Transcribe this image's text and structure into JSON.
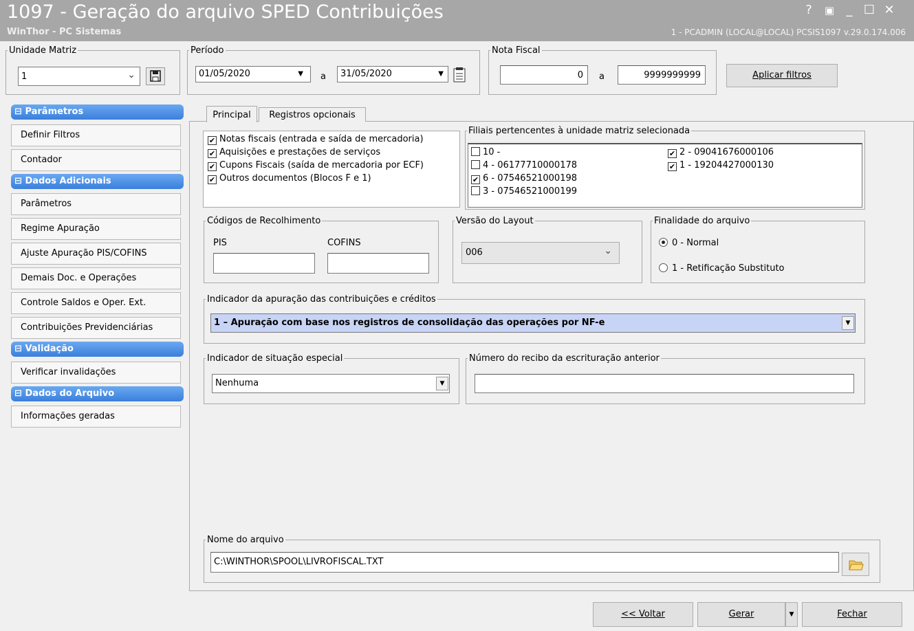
{
  "window": {
    "title": "1097 - Geração do arquivo SPED Contribuições",
    "subtitle": "WinThor - PC Sistemas",
    "user_info": "1 - PCADMIN (LOCAL@LOCAL)  PCSIS1097  v.29.0.174.006",
    "controls": [
      "?",
      "▣",
      "_",
      "☐",
      "✕"
    ]
  },
  "unidade_matriz": {
    "legend": "Unidade Matriz",
    "value": "1"
  },
  "periodo": {
    "legend": "Período",
    "from": "01/05/2020",
    "sep": "a",
    "to": "31/05/2020"
  },
  "nota_fiscal": {
    "legend": "Nota Fiscal",
    "from": "0",
    "sep": "a",
    "to": "9999999999"
  },
  "apply_button": "Aplicar filtros",
  "sidebar": {
    "sections": [
      {
        "header": "Parâmetros",
        "items": [
          "Definir Filtros",
          "Contador"
        ]
      },
      {
        "header": "Dados Adicionais",
        "items": [
          "Parâmetros",
          "Regime Apuração",
          "Ajuste Apuração PIS/COFINS",
          "Demais Doc. e Operações",
          "Controle Saldos e Oper. Ext.",
          "Contribuições Previdenciárias"
        ]
      },
      {
        "header": "Validação",
        "items": [
          "Verificar invalidações"
        ]
      },
      {
        "header": "Dados do Arquivo",
        "items": [
          "Informações geradas"
        ]
      }
    ],
    "collapse_glyph": "⊟"
  },
  "tabs": [
    {
      "label": "Principal",
      "active": true
    },
    {
      "label": "Registros opcionais",
      "active": false
    }
  ],
  "documents": [
    {
      "label": "Notas fiscais (entrada e saída de mercadoria)",
      "checked": true
    },
    {
      "label": "Aquisições e prestações de serviços",
      "checked": true
    },
    {
      "label": "Cupons Fiscais (saída de mercadoria por ECF)",
      "checked": true
    },
    {
      "label": "Outros documentos (Blocos F e 1)",
      "checked": true
    }
  ],
  "filiais": {
    "legend": "Filiais pertencentes à unidade matriz selecionada",
    "items": [
      {
        "label": "10 -",
        "checked": false
      },
      {
        "label": "4 - 06177710000178",
        "checked": false
      },
      {
        "label": "6 - 07546521000198",
        "checked": true
      },
      {
        "label": "3 - 07546521000199",
        "checked": false
      },
      {
        "label": "2 - 09041676000106",
        "checked": true
      },
      {
        "label": "1 - 19204427000130",
        "checked": true
      }
    ]
  },
  "codigos": {
    "legend": "Códigos de Recolhimento",
    "pis_label": "PIS",
    "cofins_label": "COFINS",
    "pis_value": "",
    "cofins_value": ""
  },
  "versao": {
    "legend": "Versão do Layout",
    "value": "006"
  },
  "finalidade": {
    "legend": "Finalidade do arquivo",
    "options": [
      {
        "label": "0 - Normal",
        "selected": true
      },
      {
        "label": "1 - Retificação Substituto",
        "selected": false
      }
    ]
  },
  "indicador_apuracao": {
    "legend": "Indicador da apuração das contribuições e créditos",
    "value": "1 – Apuração com base nos registros de consolidação das operações por NF-e"
  },
  "situacao_especial": {
    "legend": "Indicador de situação especial",
    "value": "Nenhuma"
  },
  "recibo": {
    "legend": "Número do recibo da escrituração anterior",
    "value": ""
  },
  "arquivo": {
    "legend": "Nome do arquivo",
    "value": "C:\\WINTHOR\\SPOOL\\LIVROFISCAL.TXT"
  },
  "footer": {
    "voltar": "<< Voltar",
    "gerar": "Gerar",
    "fechar": "Fechar"
  },
  "colors": {
    "titlebar": "#a7a7a7",
    "sidebar_header": "#3a7fdc",
    "selection": "#c8d4f5"
  }
}
